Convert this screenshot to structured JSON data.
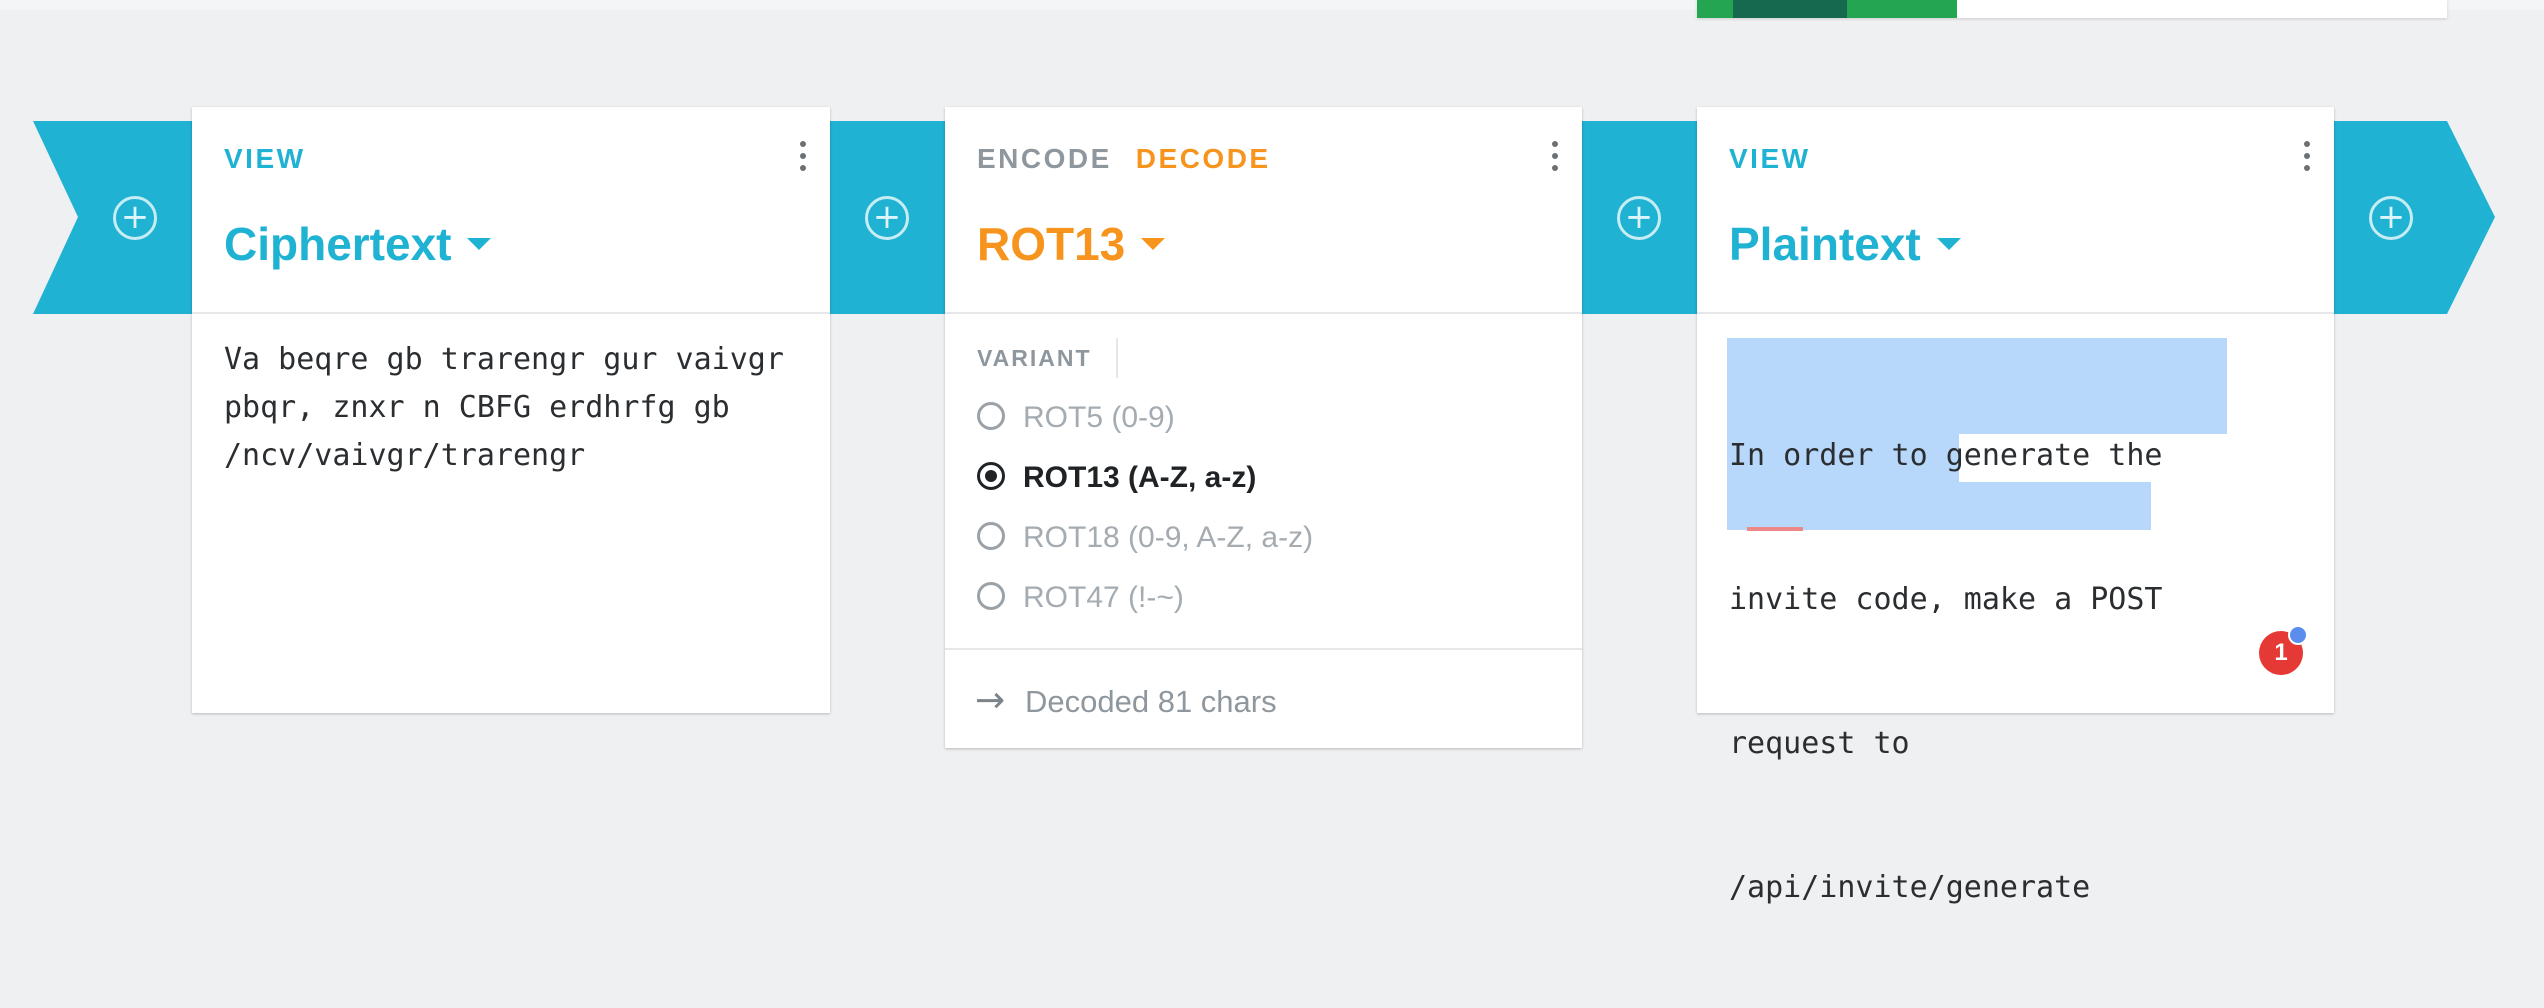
{
  "colors": {
    "accent_teal": "#1fb2d3",
    "accent_orange": "#f7941d",
    "selection": "#b7d7fb",
    "badge_red": "#e53935"
  },
  "chain": {
    "add_icon": "plus-circle-icon",
    "cards": [
      {
        "tabs": [
          "VIEW"
        ],
        "title": "Ciphertext",
        "content": "Va beqre gb trarengr gur vaivgr pbqr, znxr n CBFG erdhrfg gb /ncv/vaivgr/trarengr"
      },
      {
        "tabs": [
          "ENCODE",
          "DECODE"
        ],
        "active_tab": "DECODE",
        "title": "ROT13",
        "variant_label": "VARIANT",
        "options": [
          "ROT5 (0-9)",
          "ROT13 (A-Z, a-z)",
          "ROT18 (0-9, A-Z, a-z)",
          "ROT47 (!-~)"
        ],
        "selected_option": "ROT13 (A-Z, a-z)",
        "footer": "Decoded 81 chars",
        "footer_icon": "arrow-right-icon"
      },
      {
        "tabs": [
          "VIEW"
        ],
        "title": "Plaintext",
        "lines": [
          "In order to generate the",
          "invite code, make a POST",
          "request to",
          "/api/invite/generate"
        ],
        "badge": "1"
      }
    ]
  }
}
